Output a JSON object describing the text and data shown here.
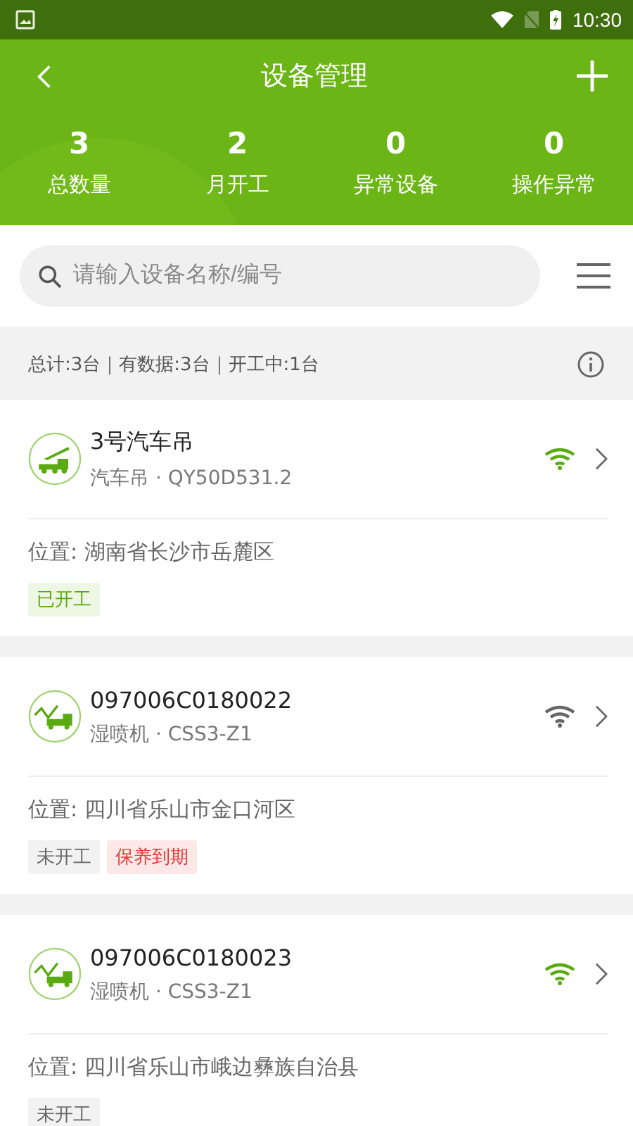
{
  "status_bar": {
    "time": "10:30"
  },
  "header": {
    "title": "设备管理"
  },
  "stats": [
    {
      "value": "3",
      "label": "总数量"
    },
    {
      "value": "2",
      "label": "月开工"
    },
    {
      "value": "0",
      "label": "异常设备"
    },
    {
      "value": "0",
      "label": "操作异常"
    }
  ],
  "search": {
    "placeholder": "请输入设备名称/编号"
  },
  "summary": {
    "text": "总计:3台｜有数据:3台｜开工中:1台"
  },
  "devices": [
    {
      "kind": "crane",
      "name": "3号汽车吊",
      "subtitle": "汽车吊 · QY50D531.2",
      "online": true,
      "location": "位置: 湖南省长沙市岳麓区",
      "tags": [
        {
          "kind": "working",
          "label": "已开工"
        }
      ]
    },
    {
      "kind": "sprayer",
      "name": "097006C0180022",
      "subtitle": "湿喷机 · CSS3-Z1",
      "online": false,
      "location": "位置: 四川省乐山市金口河区",
      "tags": [
        {
          "kind": "idle",
          "label": "未开工"
        },
        {
          "kind": "alert",
          "label": "保养到期"
        }
      ]
    },
    {
      "kind": "sprayer",
      "name": "097006C0180023",
      "subtitle": "湿喷机 · CSS3-Z1",
      "online": true,
      "location": "位置: 四川省乐山市峨边彝族自治县",
      "tags": [
        {
          "kind": "idle",
          "label": "未开工"
        }
      ]
    }
  ]
}
